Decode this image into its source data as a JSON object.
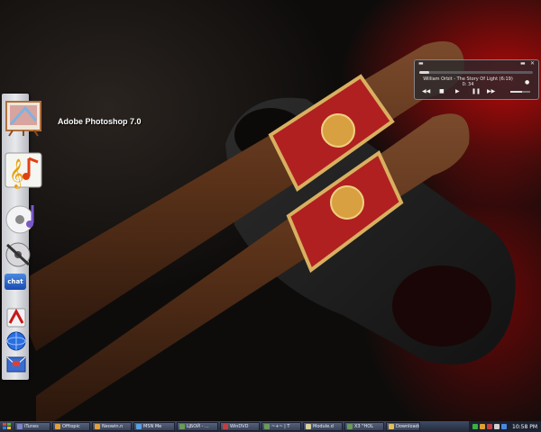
{
  "desktop": {
    "icons": [
      {
        "name": "photoshop-icon",
        "label": "Adobe Photoshop 7.0"
      },
      {
        "name": "music-notation-icon"
      },
      {
        "name": "cd-audio-icon"
      },
      {
        "name": "disc-tool-icon"
      },
      {
        "name": "chat-icon",
        "text": "chat"
      },
      {
        "name": "acrobat-icon"
      },
      {
        "name": "browser-globe-icon"
      },
      {
        "name": "mail-icon"
      }
    ]
  },
  "player": {
    "track": "William Orbit - The Story Of Light (6:19)",
    "time": "0: 34",
    "progress": 0.09,
    "volume": 0.6
  },
  "taskbar": {
    "items": [
      {
        "label": "iTunes",
        "color": "#7a86c8"
      },
      {
        "label": "Offtopic",
        "color": "#e0a040"
      },
      {
        "label": "Neowin.n",
        "color": "#e0a040"
      },
      {
        "label": "MSN Me",
        "color": "#5aa0e0"
      },
      {
        "label": "ЦБОЙ - ...",
        "color": "#6a9a5a"
      },
      {
        "label": "WinDVD",
        "color": "#c04040"
      },
      {
        "label": "~+~ | T",
        "color": "#6a9a5a"
      },
      {
        "label": "Module.d",
        "color": "#d8d0a0"
      },
      {
        "label": "X3 \"HOL",
        "color": "#6a9a5a"
      },
      {
        "label": "Downloads",
        "color": "#e0c060"
      }
    ],
    "clock": "10:58 PM"
  }
}
